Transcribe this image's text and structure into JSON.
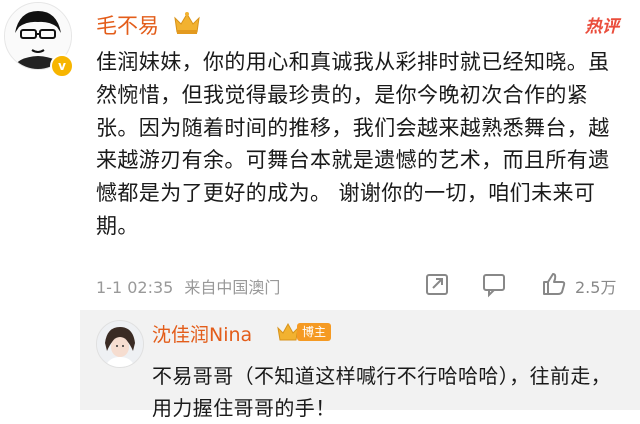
{
  "comment": {
    "user": "毛不易",
    "hot_label": "热评",
    "avatar_badge": "v",
    "text": "佳润妹妹，你的用心和真诚我从彩排时就已经知晓。虽然惋惜，但我觉得最珍贵的，是你今晚初次合作的紧张。因为随着时间的推移，我们会越来越熟悉舞台，越来越游刃有余。可舞台本就是遗憾的艺术，而且所有遗憾都是为了更好的成为。 谢谢你的一切，咱们未来可期。",
    "time": "1-1 02:35",
    "source": "来自中国澳门",
    "like_count": "2.5万",
    "icons": [
      "share-icon",
      "comment-icon",
      "like-icon"
    ]
  },
  "reply": {
    "user": "沈佳润Nina",
    "badge": "博主",
    "text": "不易哥哥（不知道这样喊行不行哈哈哈），往前走，用力握住哥哥的手！"
  },
  "colors": {
    "username": "#e35d1a",
    "hot": "#ea4d3c",
    "meta": "#999999",
    "reply_bg": "#f2f2f2"
  }
}
